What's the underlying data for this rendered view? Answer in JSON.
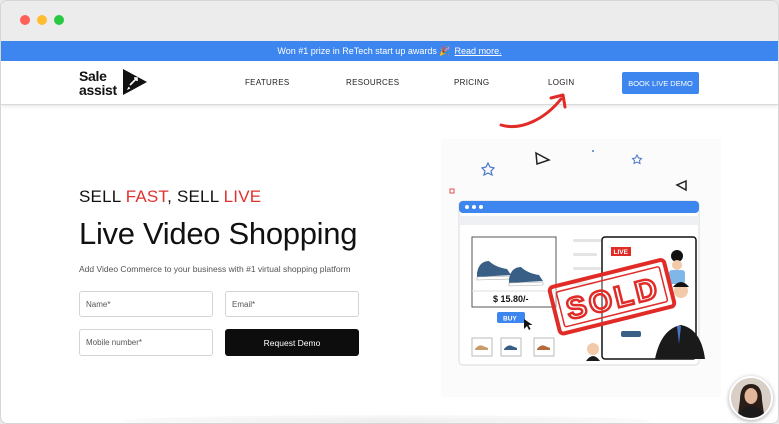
{
  "announcement": {
    "text": "Won #1 prize in ReTech start up awards 🎉",
    "link_label": "Read more."
  },
  "logo": {
    "line1": "Sale",
    "line2": "assist"
  },
  "nav": {
    "features": "FEATURES",
    "resources": "RESOURCES",
    "pricing": "PRICING",
    "login": "LOGIN",
    "book_demo": "BOOK LIVE DEMO"
  },
  "hero": {
    "sub_part1": "SELL ",
    "sub_fast": "FAST",
    "sub_part2": ", SELL ",
    "sub_live": "LIVE",
    "title": "Live Video Shopping",
    "description": "Add Video Commerce to your business with #1 virtual shopping platform"
  },
  "form": {
    "name_placeholder": "Name*",
    "email_placeholder": "Email*",
    "mobile_placeholder": "Mobile number*",
    "submit_label": "Request Demo"
  },
  "illustration": {
    "price": "$ 15.80/-",
    "buy_label": "BUY",
    "live_badge": "LIVE",
    "sold_stamp": "SOLD"
  },
  "colors": {
    "accent_blue": "#3d86ef",
    "highlight_red": "#e0322f",
    "button_black": "#0d0d0d"
  }
}
